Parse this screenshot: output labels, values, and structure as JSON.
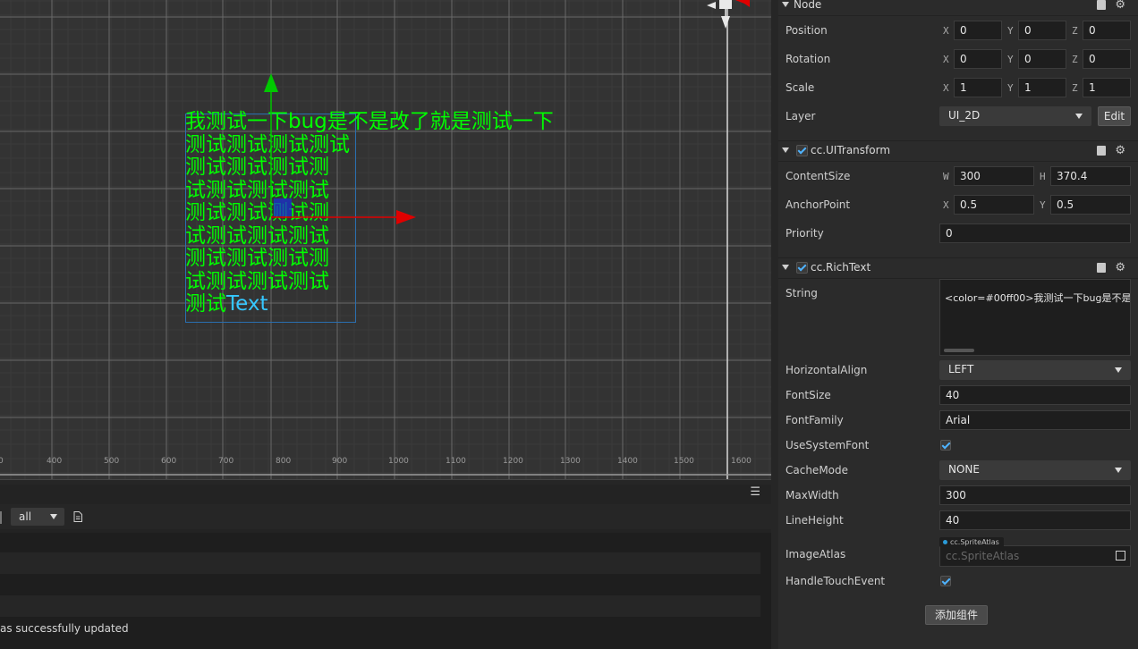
{
  "scene": {
    "ruler_labels": [
      "0",
      "400",
      "500",
      "600",
      "700",
      "800",
      "900",
      "1000",
      "1100",
      "1200",
      "1300",
      "1400",
      "1500",
      "1600"
    ],
    "rich_text_lines": [
      "我测试一下bug是不是改了就是测试一下",
      "测试测试测试测试",
      "测试测试测试测",
      "试测试测试测试",
      "测试测试测试测",
      "试测试测试测试",
      "测试测试测试测",
      "试测试测试测试"
    ],
    "rich_text_last_green": "测试",
    "rich_text_last_tail": "Text",
    "colors": {
      "text_green": "#00ff00",
      "text_tail": "#35c7ff",
      "axis_y": "#00c800",
      "axis_x": "#e00000"
    }
  },
  "console": {
    "menu_icon": "hamburger-icon",
    "filter_value": "all",
    "message": "as successfully updated"
  },
  "inspector": {
    "node": {
      "title": "Node",
      "position": {
        "label": "Position",
        "x": "0",
        "y": "0",
        "z": "0"
      },
      "rotation": {
        "label": "Rotation",
        "x": "0",
        "y": "0",
        "z": "0"
      },
      "scale": {
        "label": "Scale",
        "x": "1",
        "y": "1",
        "z": "1"
      },
      "layer": {
        "label": "Layer",
        "value": "UI_2D",
        "edit_label": "Edit"
      }
    },
    "axis_labels": {
      "x": "X",
      "y": "Y",
      "z": "Z",
      "w": "W",
      "h": "H"
    },
    "ui_transform": {
      "title": "cc.UITransform",
      "content_size": {
        "label": "ContentSize",
        "w": "300",
        "h": "370.4"
      },
      "anchor_point": {
        "label": "AnchorPoint",
        "x": "0.5",
        "y": "0.5"
      },
      "priority": {
        "label": "Priority",
        "value": "0"
      }
    },
    "rich_text": {
      "title": "cc.RichText",
      "string": {
        "label": "String",
        "value": "<color=#00ff00>我测试一下bug是不是"
      },
      "horizontal_align": {
        "label": "HorizontalAlign",
        "value": "LEFT"
      },
      "font_size": {
        "label": "FontSize",
        "value": "40"
      },
      "font_family": {
        "label": "FontFamily",
        "value": "Arial"
      },
      "use_system_font": {
        "label": "UseSystemFont",
        "checked": true
      },
      "cache_mode": {
        "label": "CacheMode",
        "value": "NONE"
      },
      "max_width": {
        "label": "MaxWidth",
        "value": "300"
      },
      "line_height": {
        "label": "LineHeight",
        "value": "40"
      },
      "image_atlas": {
        "label": "ImageAtlas",
        "badge": "cc.SpriteAtlas",
        "placeholder": "cc.SpriteAtlas"
      },
      "handle_touch_event": {
        "label": "HandleTouchEvent",
        "checked": true
      }
    },
    "add_component_label": "添加组件"
  }
}
